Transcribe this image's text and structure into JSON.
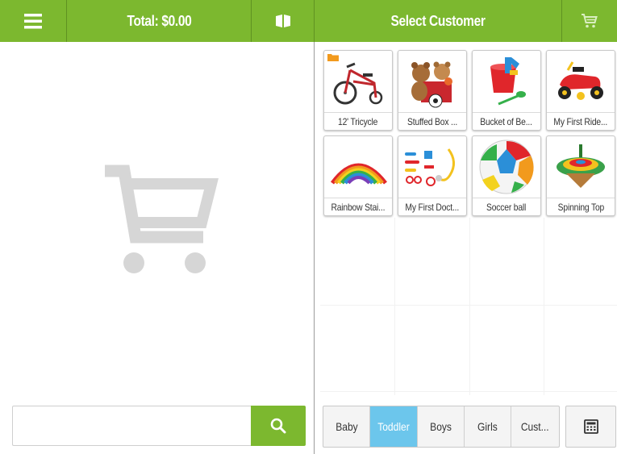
{
  "header": {
    "menu_icon": "hamburger-menu-icon",
    "total_label": "Total: $0.00",
    "toggle_icon": "drawer-toggle-icon",
    "select_customer_label": "Select Customer",
    "cart_icon": "shopping-cart-icon"
  },
  "cart": {
    "empty_icon": "shopping-cart-icon"
  },
  "search": {
    "value": "",
    "placeholder": "",
    "button_icon": "search-icon"
  },
  "products": [
    {
      "name": "12' Tricycle",
      "icon": "tricycle",
      "folder": true
    },
    {
      "name": "Stuffed Box ...",
      "icon": "teddy-bears",
      "folder": false
    },
    {
      "name": "Bucket of Be...",
      "icon": "beach-bucket",
      "folder": false
    },
    {
      "name": "My First Ride...",
      "icon": "ride-on-toy",
      "folder": false
    },
    {
      "name": "Rainbow Stai...",
      "icon": "rainbow-spring",
      "folder": false
    },
    {
      "name": "My First Doct...",
      "icon": "doctor-kit",
      "folder": false
    },
    {
      "name": "Soccer ball",
      "icon": "soccer-ball",
      "folder": false
    },
    {
      "name": "Spinning Top",
      "icon": "spinning-top",
      "folder": false
    }
  ],
  "categories": [
    {
      "label": "Baby",
      "active": false
    },
    {
      "label": "Toddler",
      "active": true
    },
    {
      "label": "Boys",
      "active": false
    },
    {
      "label": "Girls",
      "active": false
    },
    {
      "label": "Cust...",
      "active": false
    }
  ],
  "calculator_icon": "calculator-icon",
  "colors": {
    "brand_green": "#7cb82f",
    "active_tab": "#6cc6ec",
    "placeholder_gray": "#d6d6d6"
  }
}
